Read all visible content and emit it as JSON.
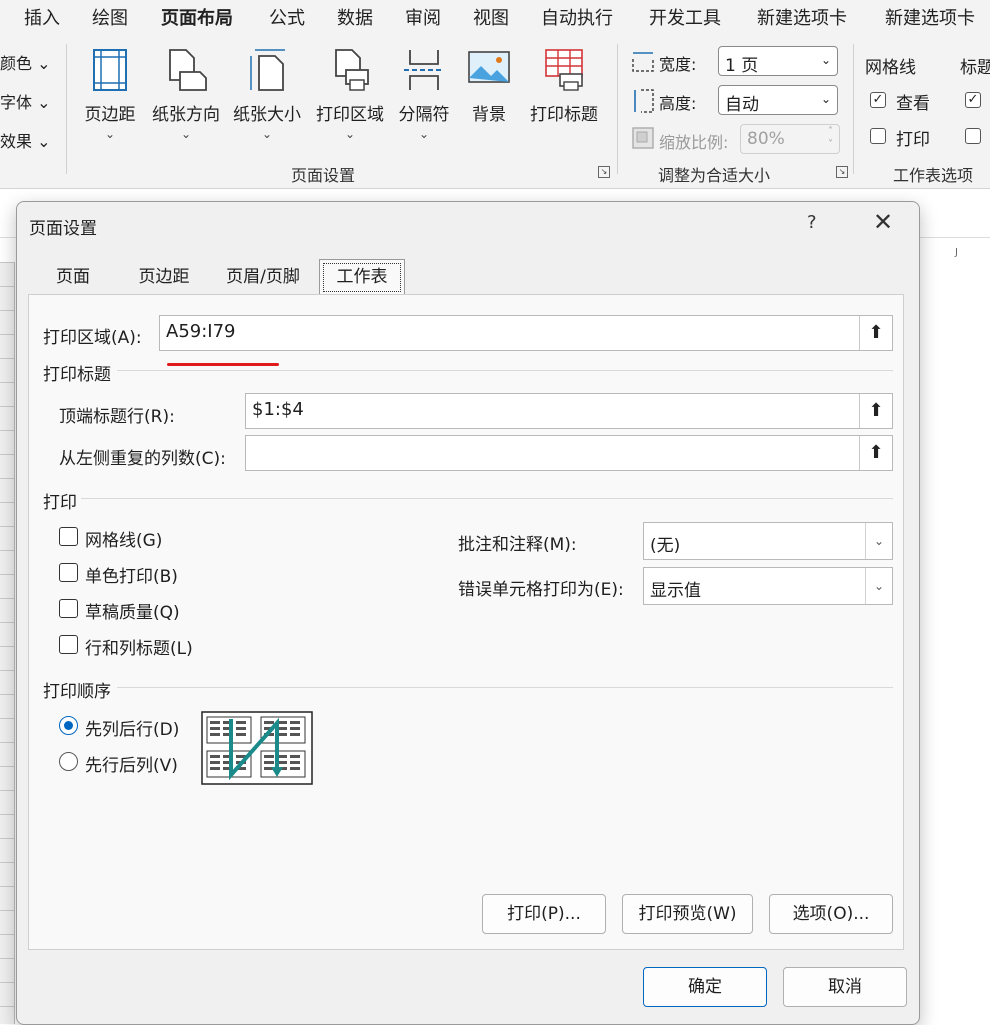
{
  "ribbon_tabs": [
    "插入",
    "绘图",
    "页面布局",
    "公式",
    "数据",
    "审阅",
    "视图",
    "自动执行",
    "开发工具",
    "新建选项卡",
    "新建选项卡"
  ],
  "ribbon_cut_items": [
    "颜色",
    "字体",
    "效果"
  ],
  "page_setup_group": {
    "label": "页面设置",
    "buttons": [
      "页边距",
      "纸张方向",
      "纸张大小",
      "打印区域",
      "分隔符",
      "背景",
      "打印标题"
    ]
  },
  "scale_group": {
    "label": "调整为合适大小",
    "width_label": "宽度:",
    "width_value": "1 页",
    "height_label": "高度:",
    "height_value": "自动",
    "scale_label": "缩放比例:",
    "scale_value": "80%"
  },
  "sheet_options_group": {
    "label": "工作表选项",
    "gridlines_header": "网格线",
    "headings_header": "标题",
    "view_label": "查看",
    "print_label": "打印",
    "gridlines_view_checked": true,
    "gridlines_print_checked": false
  },
  "column_letter": "J",
  "dialog": {
    "title": "页面设置",
    "help": "?",
    "tabs": [
      "页面",
      "页边距",
      "页眉/页脚",
      "工作表"
    ],
    "active_tab": "工作表",
    "print_area_label": "打印区域(A):",
    "print_area_value": "A59:I79",
    "print_titles_section": "打印标题",
    "top_rows_label": "顶端标题行(R):",
    "top_rows_value": "$1:$4",
    "left_cols_label": "从左侧重复的列数(C):",
    "left_cols_value": "",
    "print_section": "打印",
    "checkboxes": [
      "网格线(G)",
      "单色打印(B)",
      "草稿质量(Q)",
      "行和列标题(L)"
    ],
    "comments_label": "批注和注释(M):",
    "comments_value": "(无)",
    "errors_label": "错误单元格打印为(E):",
    "errors_value": "显示值",
    "order_section": "打印顺序",
    "order_options": [
      "先列后行(D)",
      "先行后列(V)"
    ],
    "order_selected": "先列后行(D)",
    "action_buttons": [
      "打印(P)...",
      "打印预览(W)",
      "选项(O)..."
    ],
    "ok": "确定",
    "cancel": "取消"
  },
  "colors": {
    "accent": "#0067c0",
    "annotation_red": "#e0191a",
    "preview_arrow": "#1b8a8a"
  }
}
